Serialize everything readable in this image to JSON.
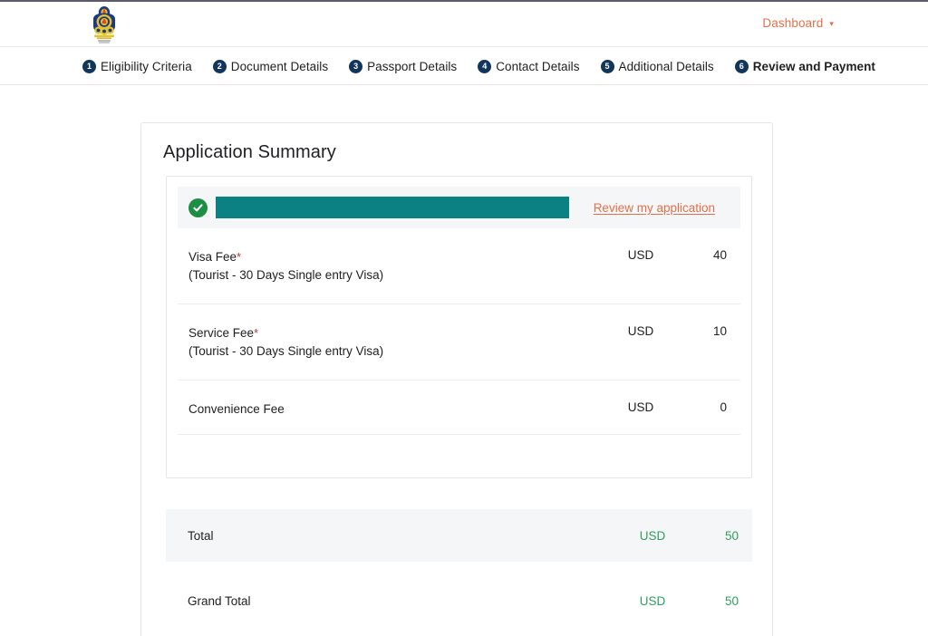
{
  "header": {
    "logo_icon": "national-emblem-logo",
    "dashboard_label": "Dashboard",
    "dashboard_caret_glyph": "▾",
    "accent_color": "#e2714a"
  },
  "stepper": {
    "steps": [
      {
        "number": "1",
        "label": "Eligibility Criteria",
        "active": false
      },
      {
        "number": "2",
        "label": "Document Details",
        "active": false
      },
      {
        "number": "3",
        "label": "Passport Details",
        "active": false
      },
      {
        "number": "4",
        "label": "Contact Details",
        "active": false
      },
      {
        "number": "5",
        "label": "Additional Details",
        "active": false
      },
      {
        "number": "6",
        "label": "Review and Payment",
        "active": true
      }
    ],
    "badge_color": "#12355b"
  },
  "main": {
    "title": "Application Summary",
    "applicant_banner": {
      "status_icon": "green-check-icon",
      "redacted_value": "",
      "review_link_label": "Review my application",
      "redaction_color": "#0b8183",
      "check_color": "#1d8f43"
    },
    "fees": [
      {
        "name": "Visa Fee",
        "required": true,
        "required_marker": "*",
        "sub": "(Tourist - 30 Days Single entry Visa)",
        "currency": "USD",
        "amount": "40"
      },
      {
        "name": "Service Fee",
        "required": true,
        "required_marker": "*",
        "sub": "(Tourist - 30 Days Single entry Visa)",
        "currency": "USD",
        "amount": "10"
      },
      {
        "name": "Convenience Fee",
        "required": false,
        "required_marker": "",
        "sub": "",
        "currency": "USD",
        "amount": "0"
      }
    ],
    "total": {
      "label": "Total",
      "currency": "USD",
      "amount": "50"
    },
    "grand_total": {
      "label": "Grand Total",
      "currency": "USD",
      "amount": "50"
    },
    "total_color": "#2f9e5c"
  }
}
